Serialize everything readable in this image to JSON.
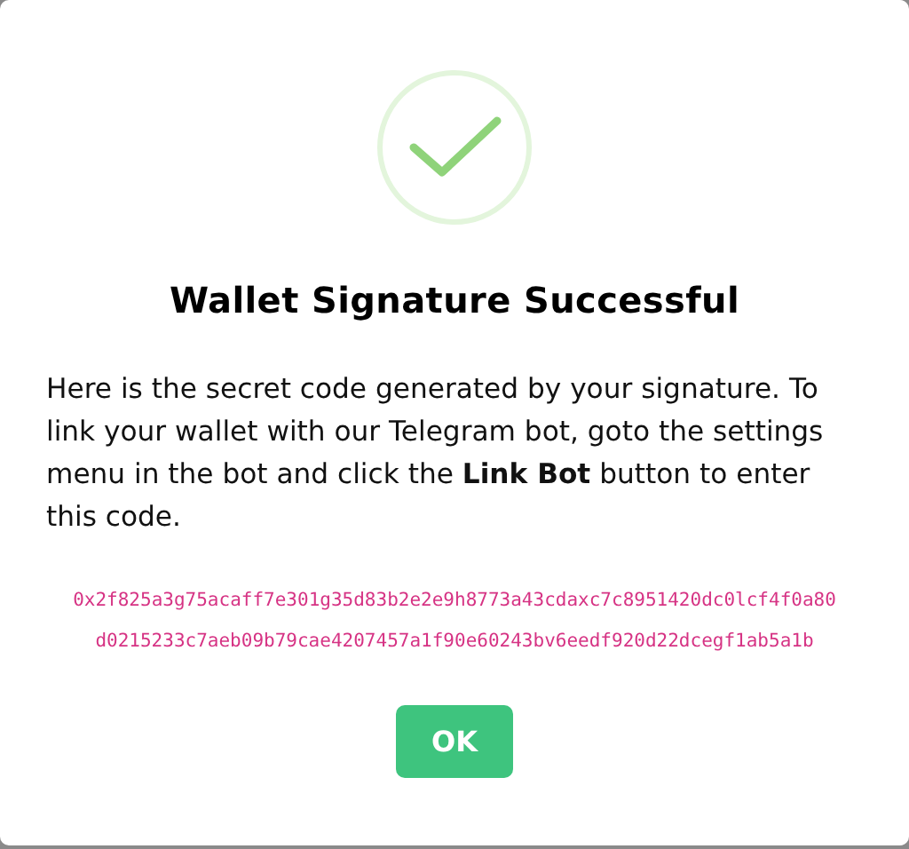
{
  "dialog": {
    "title": "Wallet Signature Successful",
    "message": "Here is the secret code generated by your signature. To link your wallet with our Telegram bot, goto the settings menu in the bot and click the **Link Bot** button to enter this code.",
    "code_lines": [
      "0x2f825a3g75acaff7e301g35d83b2e2e9h8773a43cdaxc7c8951420dc0lcf4f0a80",
      "d0215233c7aeb09b79cae4207457a1f90e60243bv6eedf920d22dcegf1ab5a1b"
    ],
    "kind": "success",
    "button": "OK"
  }
}
